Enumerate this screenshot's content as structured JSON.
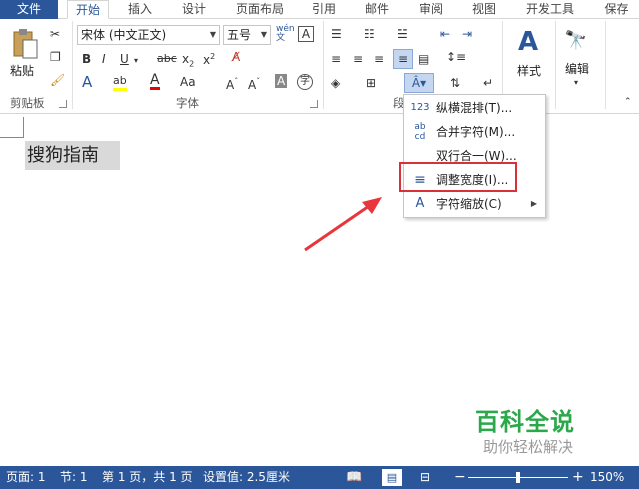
{
  "tabs": [
    "文件",
    "开始",
    "插入",
    "设计",
    "页面布局",
    "引用",
    "邮件",
    "审阅",
    "视图",
    "开发工具",
    "保存"
  ],
  "clipboard": {
    "paste_label": "粘贴",
    "group_label": "剪贴板"
  },
  "font": {
    "name": "宋体 (中文正文)",
    "size": "五号",
    "wen_label": "wén 文",
    "group_label": "字体"
  },
  "paragraph": {
    "group_label": "段"
  },
  "styles": {
    "label": "样式"
  },
  "editing": {
    "label": "编辑"
  },
  "document": {
    "text": "搜狗指南"
  },
  "menu": {
    "items": [
      {
        "icon": "123",
        "label": "纵横混排(T)..."
      },
      {
        "icon": "ab cd",
        "label": "合并字符(M)..."
      },
      {
        "icon": "",
        "label": "双行合一(W)..."
      },
      {
        "icon": "≡",
        "label": "调整宽度(I)..."
      },
      {
        "icon": "A",
        "label": "字符缩放(C)"
      }
    ]
  },
  "status": {
    "page": "页面: 1",
    "section": "节: 1",
    "pages": "第 1 页，共 1 页",
    "setting": "设置值: 2.5厘米",
    "zoom": "150%"
  },
  "watermark": {
    "title": "百科全说",
    "subtitle": "助你轻松解决"
  },
  "colors": {
    "accent": "#2b579a",
    "highlight": "#d9303a",
    "arrow": "#e8363c",
    "watermark": "#2aa84a"
  }
}
